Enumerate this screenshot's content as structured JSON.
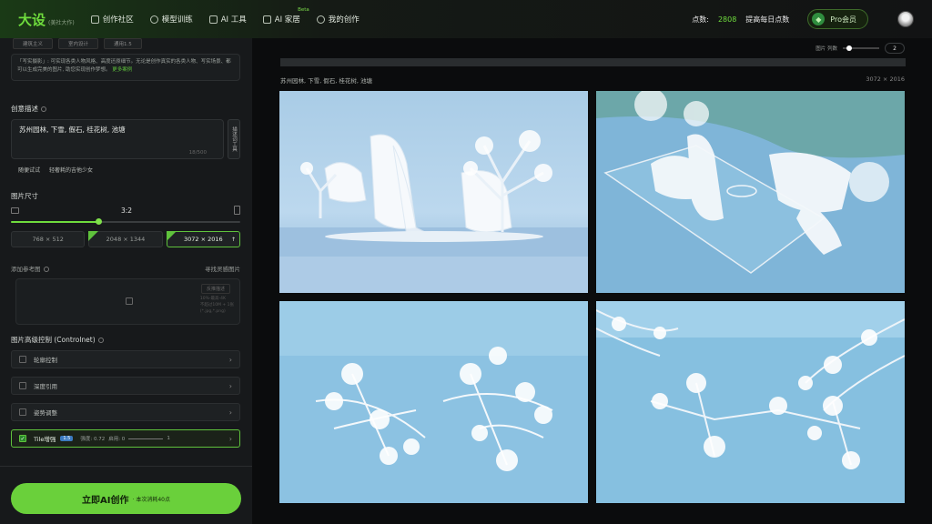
{
  "header": {
    "logo_main": "大设",
    "logo_sub": "(美社大作)",
    "nav": [
      {
        "label": "创作社区",
        "icon": "grid-icon"
      },
      {
        "label": "模型训练",
        "icon": "model-icon"
      },
      {
        "label": "AI 工具",
        "icon": "ai-icon"
      },
      {
        "label": "AI 家居",
        "icon": "home-icon",
        "badge": "Beta"
      },
      {
        "label": "我的创作",
        "icon": "create-icon"
      }
    ],
    "points_label": "点数:",
    "points_value": "2808",
    "points_action": "提高每日点数",
    "pro_label": "Pro会员",
    "colors": {
      "accent": "#6fdc3d",
      "bg": "#121314"
    }
  },
  "sidebar": {
    "style_chips": [
      "建筑主义",
      "室内设计",
      "通用1.5"
    ],
    "style_desc": "「写实摄影」: 可实现各类人物风格、高度还原细节。无论是创作真实的各类人物、写实场景、都可以生成完美的图片, 助您实现创作梦想。",
    "style_desc_link": "更多案例",
    "prompt_title": "创意描述",
    "prompt_text": "苏州园林, 下雪, 假石, 桂花树, 池塘",
    "prompt_count": "18/500",
    "prompt_tool": "描述词工具",
    "hint_1": "随便试试",
    "hint_2": "轻奢耗的吉他少女",
    "size_title": "图片尺寸",
    "ratio_label": "3:2",
    "ratio_slider_value": 0.38,
    "sizes": [
      {
        "label": "768 × 512",
        "active": false,
        "badge": false
      },
      {
        "label": "2048 × 1344",
        "active": false,
        "badge": true
      },
      {
        "label": "3072 × 2016",
        "active": true,
        "badge": true
      }
    ],
    "ref_title": "添加参考图",
    "ref_action": "寻找灵感图片",
    "ref_reverse": "反推描述",
    "ref_limits": [
      "10%-最高-4K",
      "不超过10M + 1张",
      "(*.jpg,*.png)"
    ],
    "control_title": "图片高级控制 (Controlnet)",
    "controls": [
      {
        "label": "轮廓控制",
        "checked": false
      },
      {
        "label": "深度引用",
        "checked": false
      },
      {
        "label": "姿势调整",
        "checked": false
      },
      {
        "label": "Tile增强",
        "checked": true,
        "tag": "1.5",
        "strength_label": "强度: 0.72",
        "start_label": "启用: 0",
        "end_label": "1"
      }
    ],
    "cta_label": "立即AI创作",
    "cta_sub": "· 本次消耗40点"
  },
  "main": {
    "count_label": "图片 列数",
    "count_value": "2",
    "count_slider_value": 0.1,
    "caption": "苏州园林, 下雪, 假石, 桂花树, 池塘",
    "dims": "3072 × 2016",
    "images": [
      {
        "alt": "snow-calligraphy-garden-tree"
      },
      {
        "alt": "snow-calligraphy-aerial-lake"
      },
      {
        "alt": "snow-calligraphy-branches-ice"
      },
      {
        "alt": "snow-calligraphy-blossom-branches"
      }
    ]
  }
}
